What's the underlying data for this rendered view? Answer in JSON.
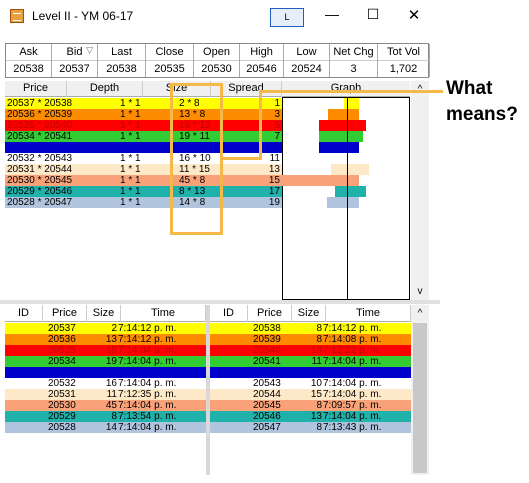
{
  "window": {
    "title": "Level II - YM 06-17",
    "l_button": "L",
    "minimize": "—",
    "maximize": "☐",
    "close": "✕"
  },
  "summary": {
    "headers": [
      "Ask",
      "Bid",
      "Last",
      "Close",
      "Open",
      "High",
      "Low",
      "Net Chg",
      "Tot Vol"
    ],
    "values": [
      "20538",
      "20537",
      "20538",
      "20535",
      "20530",
      "20546",
      "20524",
      "3",
      "1,702"
    ],
    "bid_filter_icon": "▽"
  },
  "depth": {
    "headers": [
      "Price",
      "Depth",
      "Size",
      "Spread"
    ],
    "rows": [
      {
        "price": "20537 * 20538",
        "depth": "1 * 1",
        "size": "2 * 8",
        "spread": "1",
        "color": "#ffff00",
        "text": "#000000"
      },
      {
        "price": "20536 * 20539",
        "depth": "1 * 1",
        "size": "13 * 8",
        "spread": "3",
        "color": "#ff8c00",
        "text": "#000000"
      },
      {
        "price": "20535 * 20540",
        "depth": "1 * 1",
        "size": "19 * 13",
        "spread": "5",
        "color": "#ff0000",
        "text": "#c00000"
      },
      {
        "price": "20534 * 20541",
        "depth": "1 * 1",
        "size": "19 * 11",
        "spread": "7",
        "color": "#32cd32",
        "text": "#000000"
      },
      {
        "price": "20533 * 20542",
        "depth": "1 * 1",
        "size": "19 * 8",
        "spread": "9",
        "color": "#0000cd",
        "text": "#0000cd"
      },
      {
        "price": "20532 * 20543",
        "depth": "1 * 1",
        "size": "16 * 10",
        "spread": "11",
        "color": "#ffffff",
        "text": "#000000"
      },
      {
        "price": "20531 * 20544",
        "depth": "1 * 1",
        "size": "11 * 15",
        "spread": "13",
        "color": "#fde9c8",
        "text": "#000000"
      },
      {
        "price": "20530 * 20545",
        "depth": "1 * 1",
        "size": "45 * 8",
        "spread": "15",
        "color": "#f9a27a",
        "text": "#000000"
      },
      {
        "price": "20529 * 20546",
        "depth": "1 * 1",
        "size": "8 * 13",
        "spread": "17",
        "color": "#20b2aa",
        "text": "#000000"
      },
      {
        "price": "20528 * 20547",
        "depth": "1 * 1",
        "size": "14 * 8",
        "spread": "19",
        "color": "#b0c4de",
        "text": "#000000"
      }
    ]
  },
  "graph": {
    "header": "Graph",
    "bars": [
      {
        "bid": 2,
        "ask": 8,
        "color": "#ffff00"
      },
      {
        "bid": 13,
        "ask": 8,
        "color": "#ff8c00"
      },
      {
        "bid": 19,
        "ask": 13,
        "color": "#ff0000"
      },
      {
        "bid": 19,
        "ask": 11,
        "color": "#32cd32"
      },
      {
        "bid": 19,
        "ask": 8,
        "color": "#0000cd"
      },
      {
        "bid": 16,
        "ask": 10,
        "color": "#ffffff"
      },
      {
        "bid": 11,
        "ask": 15,
        "color": "#fde9c8"
      },
      {
        "bid": 45,
        "ask": 8,
        "color": "#f9a27a"
      },
      {
        "bid": 8,
        "ask": 13,
        "color": "#20b2aa"
      },
      {
        "bid": 14,
        "ask": 8,
        "color": "#b0c4de"
      }
    ]
  },
  "scrollbar": {
    "up": "^",
    "down": "v"
  },
  "bids_table": {
    "headers": [
      "ID",
      "Price",
      "Size",
      "Time"
    ],
    "rows": [
      {
        "price": "20537",
        "size": "2",
        "time": "7:14:12 p. m.",
        "color": "#ffff00",
        "text": "#000000"
      },
      {
        "price": "20536",
        "size": "13",
        "time": "7:14:12 p. m.",
        "color": "#ff8c00",
        "text": "#000000"
      },
      {
        "price": "20535",
        "size": "19",
        "time": "7:14:04 p. m.",
        "color": "#ff0000",
        "text": "#c00000"
      },
      {
        "price": "20534",
        "size": "19",
        "time": "7:14:04 p. m.",
        "color": "#32cd32",
        "text": "#000000"
      },
      {
        "price": "20533",
        "size": "19",
        "time": "7:14:04 p. m.",
        "color": "#0000cd",
        "text": "#0000cd"
      },
      {
        "price": "20532",
        "size": "16",
        "time": "7:14:04 p. m.",
        "color": "#ffffff",
        "text": "#000000"
      },
      {
        "price": "20531",
        "size": "11",
        "time": "7:12:35 p. m.",
        "color": "#fde9c8",
        "text": "#000000"
      },
      {
        "price": "20530",
        "size": "45",
        "time": "7:14:04 p. m.",
        "color": "#f9a27a",
        "text": "#000000"
      },
      {
        "price": "20529",
        "size": "8",
        "time": "7:13:54 p. m.",
        "color": "#20b2aa",
        "text": "#000000"
      },
      {
        "price": "20528",
        "size": "14",
        "time": "7:14:04 p. m.",
        "color": "#b0c4de",
        "text": "#000000"
      }
    ]
  },
  "asks_table": {
    "headers": [
      "ID",
      "Price",
      "Size",
      "Time"
    ],
    "rows": [
      {
        "price": "20538",
        "size": "8",
        "time": "7:14:12 p. m.",
        "color": "#ffff00",
        "text": "#000000"
      },
      {
        "price": "20539",
        "size": "8",
        "time": "7:14:08 p. m.",
        "color": "#ff8c00",
        "text": "#000000"
      },
      {
        "price": "20540",
        "size": "13",
        "time": "7:12:22 p. m.",
        "color": "#ff0000",
        "text": "#c00000"
      },
      {
        "price": "20541",
        "size": "11",
        "time": "7:14:04 p. m.",
        "color": "#32cd32",
        "text": "#000000"
      },
      {
        "price": "20542",
        "size": "8",
        "time": "7:14:04 p. m.",
        "color": "#0000cd",
        "text": "#0000cd"
      },
      {
        "price": "20543",
        "size": "10",
        "time": "7:14:04 p. m.",
        "color": "#ffffff",
        "text": "#000000"
      },
      {
        "price": "20544",
        "size": "15",
        "time": "7:14:04 p. m.",
        "color": "#fde9c8",
        "text": "#000000"
      },
      {
        "price": "20545",
        "size": "8",
        "time": "7:09:57 p. m.",
        "color": "#f9a27a",
        "text": "#000000"
      },
      {
        "price": "20546",
        "size": "13",
        "time": "7:14:04 p. m.",
        "color": "#20b2aa",
        "text": "#000000"
      },
      {
        "price": "20547",
        "size": "8",
        "time": "7:13:43 p. m.",
        "color": "#b0c4de",
        "text": "#000000"
      }
    ]
  },
  "annotation": {
    "line1": "What",
    "line2": "means?",
    "color": "#f5b94a"
  }
}
